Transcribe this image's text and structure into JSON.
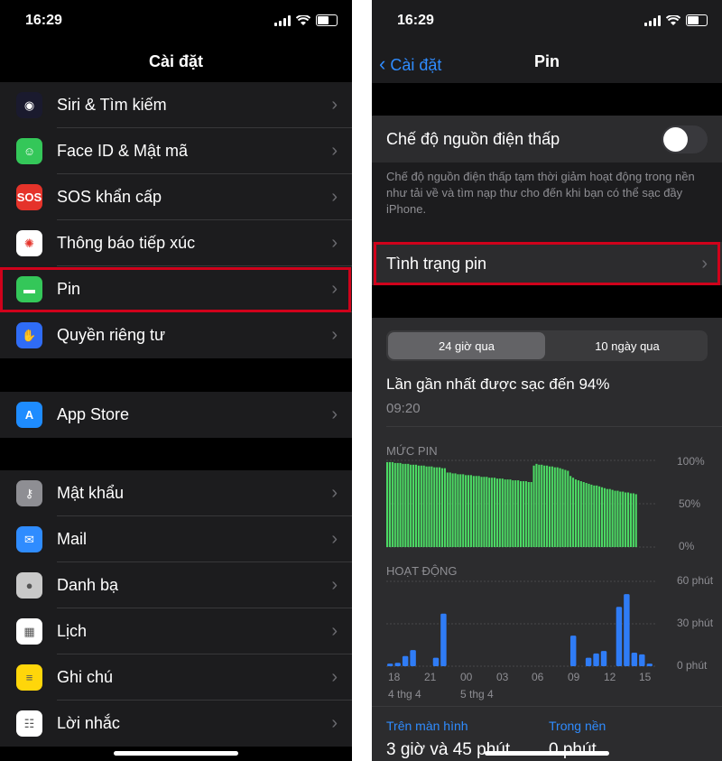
{
  "left": {
    "time": "16:29",
    "title": "Cài đặt",
    "group1": [
      {
        "label": "Siri & Tìm kiếm",
        "icon": "siri-icon",
        "color": "#1a1a2e"
      },
      {
        "label": "Face ID & Mật mã",
        "icon": "face-id-icon",
        "color": "#34c759"
      },
      {
        "label": "SOS khẩn cấp",
        "icon": "sos-icon",
        "icon_text": "SOS",
        "color": "#e5332a"
      },
      {
        "label": "Thông báo tiếp xúc",
        "icon": "exposure-notification-icon",
        "color": "#ffffff"
      },
      {
        "label": "Pin",
        "icon": "battery-icon",
        "color": "#34c759"
      },
      {
        "label": "Quyền riêng tư",
        "icon": "hand-icon",
        "color": "#2f6cf5"
      }
    ],
    "group2": [
      {
        "label": "App Store",
        "icon": "app-store-icon",
        "color": "#1e8cff"
      }
    ],
    "group3": [
      {
        "label": "Mật khẩu",
        "icon": "key-icon",
        "color": "#8e8e93"
      },
      {
        "label": "Mail",
        "icon": "mail-icon",
        "color": "#2f8cff"
      },
      {
        "label": "Danh bạ",
        "icon": "contacts-icon",
        "color": "#c9c9c9"
      },
      {
        "label": "Lịch",
        "icon": "calendar-icon",
        "color": "#ffffff"
      },
      {
        "label": "Ghi chú",
        "icon": "notes-icon",
        "color": "#ffd60a"
      },
      {
        "label": "Lời nhắc",
        "icon": "reminders-icon",
        "color": "#ffffff"
      }
    ]
  },
  "right": {
    "time": "16:29",
    "back_label": "Cài đặt",
    "title": "Pin",
    "low_power_label": "Chế độ nguồn điện thấp",
    "low_power_on": false,
    "low_power_desc": "Chế độ nguồn điện thấp tạm thời giảm hoạt động trong nền như tải về và tìm nạp thư cho đến khi bạn có thể sạc đầy iPhone.",
    "battery_health_label": "Tình trạng pin",
    "tabs": [
      "24 giờ qua",
      "10 ngày qua"
    ],
    "last_charge": "Lần gần nhất được sạc đến 94%",
    "last_charge_time": "09:20",
    "level_title": "MỨC PIN",
    "level_ticks": [
      "100%",
      "50%",
      "0%"
    ],
    "activity_title": "HOẠT ĐỘNG",
    "activity_ticks": [
      "60 phút",
      "30 phút",
      "0 phút"
    ],
    "x_labels": [
      "18",
      "21",
      "00",
      "03",
      "06",
      "09",
      "12",
      "15"
    ],
    "date_labels": [
      "4 thg 4",
      "5 thg 4"
    ],
    "screen_on_label": "Trên màn hình",
    "screen_on_value": "3 giờ và 45 phút",
    "background_label": "Trong nền",
    "background_value": "0 phút"
  },
  "colors": {
    "accent": "#2f8cff",
    "highlight": "#d0021b",
    "battery_green": "#4cd964",
    "activity_blue": "#2f7cf6"
  },
  "battery_level": [
    98,
    98,
    98,
    97,
    97,
    97,
    96,
    96,
    96,
    95,
    95,
    95,
    94,
    94,
    94,
    93,
    93,
    93,
    92,
    92,
    92,
    91,
    91,
    86,
    86,
    85,
    85,
    84,
    84,
    84,
    83,
    83,
    83,
    82,
    82,
    82,
    81,
    81,
    81,
    80,
    80,
    80,
    79,
    79,
    79,
    78,
    78,
    78,
    77,
    77,
    77,
    76,
    76,
    76,
    75,
    75,
    94,
    96,
    95,
    95,
    94,
    94,
    93,
    93,
    92,
    92,
    91,
    90,
    89,
    88,
    82,
    80,
    78,
    77,
    76,
    75,
    74,
    73,
    72,
    71,
    71,
    70,
    69,
    68,
    67,
    67,
    66,
    65,
    65,
    64,
    64,
    63,
    63,
    62,
    62,
    61
  ],
  "activity": [
    3,
    4,
    12,
    19,
    0,
    0,
    10,
    62,
    0,
    0,
    0,
    0,
    0,
    0,
    0,
    0,
    0,
    0,
    0,
    0,
    0,
    0,
    0,
    0,
    36,
    0,
    10,
    15,
    18,
    0,
    70,
    85,
    16,
    14,
    3
  ]
}
